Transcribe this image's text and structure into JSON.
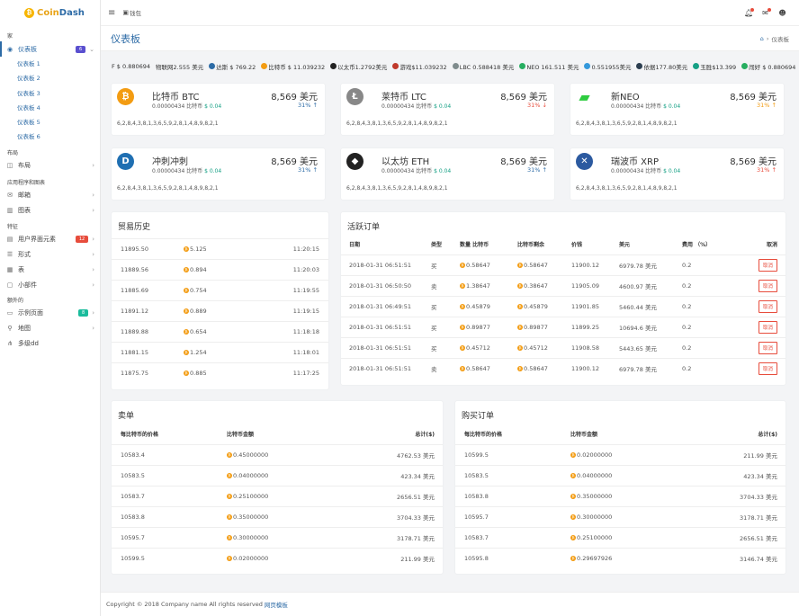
{
  "brand": {
    "part1": "Coin",
    "part2": "Dash"
  },
  "topbar": {
    "wallet_label": "钱包"
  },
  "page": {
    "title": "仪表板",
    "breadcrumb_current": "仪表板"
  },
  "sidebar": {
    "sec_home": "家",
    "dashboard": {
      "label": "仪表板",
      "badge": "6",
      "badge_color": "#5a4fcf"
    },
    "subs": [
      "仪表板 1",
      "仪表板 2",
      "仪表板 3",
      "仪表板 4",
      "仪表板 5",
      "仪表板 6"
    ],
    "sec_layout": "布局",
    "layout": "布局",
    "sec_apps": "应用程序和图表",
    "mail": "邮箱",
    "charts": "图表",
    "sec_features": "特征",
    "ui": {
      "label": "用户界面元素",
      "badge": "12",
      "badge_color": "#e74c3c"
    },
    "forms": "形式",
    "tables": "表",
    "widgets": "小部件",
    "sec_extra": "额外的",
    "sample": {
      "label": "示例页面",
      "badge": "8",
      "badge_color": "#1abc9c"
    },
    "maps": "地图",
    "multi": "多级dd"
  },
  "ticker": [
    {
      "t": "F $ 0.880694",
      "c": ""
    },
    {
      "t": "物联网2.555 美元",
      "c": ""
    },
    {
      "t": "达斯 $ 769.22",
      "c": "#2d6ba6"
    },
    {
      "t": "比特币 $ 11.039232",
      "c": "#f39c12"
    },
    {
      "t": "以太币1.2792美元",
      "c": "#222"
    },
    {
      "t": "游戏$11.039232",
      "c": "#c0392b"
    },
    {
      "t": "LBC 0.588418 美元",
      "c": "#7f8c8d"
    },
    {
      "t": "NEO 161.511 美元",
      "c": "#27ae60"
    },
    {
      "t": "0.551955美元",
      "c": "#3498db"
    },
    {
      "t": "依据177.80美元",
      "c": "#2c3e50"
    },
    {
      "t": "玉胜$13.399",
      "c": "#16a085"
    },
    {
      "t": "闯好 $ 0.880694",
      "c": "#27ae60"
    },
    {
      "t": "物联",
      "c": ""
    }
  ],
  "coins": [
    {
      "name": "比特币 BTC",
      "price": "8,569 美元",
      "sub_a": "0.00000434 比特币",
      "sub_b": "$ 0.04",
      "change": "31%",
      "arrow": "↑",
      "dir": "teal",
      "spark": "6,2,8,4,3,8,1,3,6,5,9,2,8,1,4,8,9,8,2,1",
      "color": "#f39c12",
      "glyph": "₿"
    },
    {
      "name": "莱特币 LTC",
      "price": "8,569 美元",
      "sub_a": "0.00000434 比特币",
      "sub_b": "$ 0.04",
      "change": "31%",
      "arrow": "↓",
      "dir": "red",
      "spark": "6,2,8,4,3,8,1,3,6,5,9,2,8,1,4,8,9,8,2,1",
      "color": "#888",
      "glyph": "Ł"
    },
    {
      "name": "新NEO",
      "price": "8,569 美元",
      "sub_a": "0.00000434 比特币",
      "sub_b": "$ 0.04",
      "change": "31%",
      "arrow": "↑",
      "dir": "orange",
      "spark": "6,2,8,4,3,8,1,3,6,5,9,2,8,1,4,8,9,8,2,1",
      "color": "#2ecc40",
      "glyph": "▰"
    },
    {
      "name": "冲刺冲刺",
      "price": "8,569 美元",
      "sub_a": "0.00000434 比特币",
      "sub_b": "$ 0.04",
      "change": "31%",
      "arrow": "↑",
      "dir": "teal",
      "spark": "6,2,8,4,3,8,1,3,6,5,9,2,8,1,4,8,9,8,2,1",
      "color": "#1f6fb2",
      "glyph": "D"
    },
    {
      "name": "以太坊 ETH",
      "price": "8,569 美元",
      "sub_a": "0.00000434 比特币",
      "sub_b": "$ 0.04",
      "change": "31%",
      "arrow": "↑",
      "dir": "teal",
      "spark": "6,2,8,4,3,8,1,3,6,5,9,2,8,1,4,8,9,8,2,1",
      "color": "#222",
      "glyph": "◆"
    },
    {
      "name": "瑞波币 XRP",
      "price": "8,569 美元",
      "sub_a": "0.00000434 比特币",
      "sub_b": "$ 0.04",
      "change": "31%",
      "arrow": "↑",
      "dir": "red",
      "spark": "6,2,8,4,3,8,1,3,6,5,9,2,8,1,4,8,9,8,2,1",
      "color": "#2c5aa0",
      "glyph": "✕"
    }
  ],
  "trade_history": {
    "title": "贸易历史",
    "rows": [
      {
        "p": "11895.50",
        "a": "5.125",
        "t": "11:20:15",
        "c": "red"
      },
      {
        "p": "11889.56",
        "a": "0.894",
        "t": "11:20:03",
        "c": "red"
      },
      {
        "p": "11885.69",
        "a": "0.754",
        "t": "11:19:55",
        "c": "green"
      },
      {
        "p": "11891.12",
        "a": "0.889",
        "t": "11:19:15",
        "c": "red"
      },
      {
        "p": "11889.88",
        "a": "0.654",
        "t": "11:18:18",
        "c": "red"
      },
      {
        "p": "11881.15",
        "a": "1.254",
        "t": "11:18:01",
        "c": "green"
      },
      {
        "p": "11875.75",
        "a": "0.885",
        "t": "11:17:25",
        "c": "green"
      }
    ]
  },
  "active_orders": {
    "title": "活跃订单",
    "headers": [
      "日期",
      "类型",
      "数量 比特币",
      "比特币剩余",
      "价钱",
      "美元",
      "费用 （%）",
      "取消"
    ],
    "cancel_label": "取消",
    "rows": [
      {
        "d": "2018-01-31 06:51:51",
        "ty": "买",
        "q": "0.58647",
        "r": "0.58647",
        "p": "11900.12",
        "u": "6979.78 美元",
        "f": "0.2"
      },
      {
        "d": "2018-01-31 06:50:50",
        "ty": "卖",
        "q": "1.38647",
        "r": "0.38647",
        "p": "11905.09",
        "u": "4600.97 美元",
        "f": "0.2"
      },
      {
        "d": "2018-01-31 06:49:51",
        "ty": "买",
        "q": "0.45879",
        "r": "0.45879",
        "p": "11901.85",
        "u": "5460.44 美元",
        "f": "0.2"
      },
      {
        "d": "2018-01-31 06:51:51",
        "ty": "买",
        "q": "0.89877",
        "r": "0.89877",
        "p": "11899.25",
        "u": "10694.6 美元",
        "f": "0.2"
      },
      {
        "d": "2018-01-31 06:51:51",
        "ty": "买",
        "q": "0.45712",
        "r": "0.45712",
        "p": "11908.58",
        "u": "5443.65 美元",
        "f": "0.2"
      },
      {
        "d": "2018-01-31 06:51:51",
        "ty": "卖",
        "q": "0.58647",
        "r": "0.58647",
        "p": "11900.12",
        "u": "6979.78 美元",
        "f": "0.2"
      }
    ]
  },
  "sell_orders": {
    "title": "卖单",
    "headers": [
      "每比特币的价格",
      "比特币金额",
      "总计($)"
    ],
    "rows": [
      {
        "p": "10583.4",
        "a": "0.45000000",
        "t": "4762.53 美元"
      },
      {
        "p": "10583.5",
        "a": "0.04000000",
        "t": "423.34 美元"
      },
      {
        "p": "10583.7",
        "a": "0.25100000",
        "t": "2656.51 美元"
      },
      {
        "p": "10583.8",
        "a": "0.35000000",
        "t": "3704.33 美元"
      },
      {
        "p": "10595.7",
        "a": "0.30000000",
        "t": "3178.71 美元"
      },
      {
        "p": "10599.5",
        "a": "0.02000000",
        "t": "211.99 美元"
      }
    ]
  },
  "buy_orders": {
    "title": "购买订单",
    "headers": [
      "每比特币的价格",
      "比特币金额",
      "总计($)"
    ],
    "rows": [
      {
        "p": "10599.5",
        "a": "0.02000000",
        "t": "211.99 美元"
      },
      {
        "p": "10583.5",
        "a": "0.04000000",
        "t": "423.34 美元"
      },
      {
        "p": "10583.8",
        "a": "0.35000000",
        "t": "3704.33 美元"
      },
      {
        "p": "10595.7",
        "a": "0.30000000",
        "t": "3178.71 美元"
      },
      {
        "p": "10583.7",
        "a": "0.25100000",
        "t": "2656.51 美元"
      },
      {
        "p": "10595.8",
        "a": "0.29697926",
        "t": "3146.74 美元"
      }
    ]
  },
  "footer": {
    "text": "Copyright © 2018 Company name All rights reserved",
    "link": "网页模板"
  }
}
